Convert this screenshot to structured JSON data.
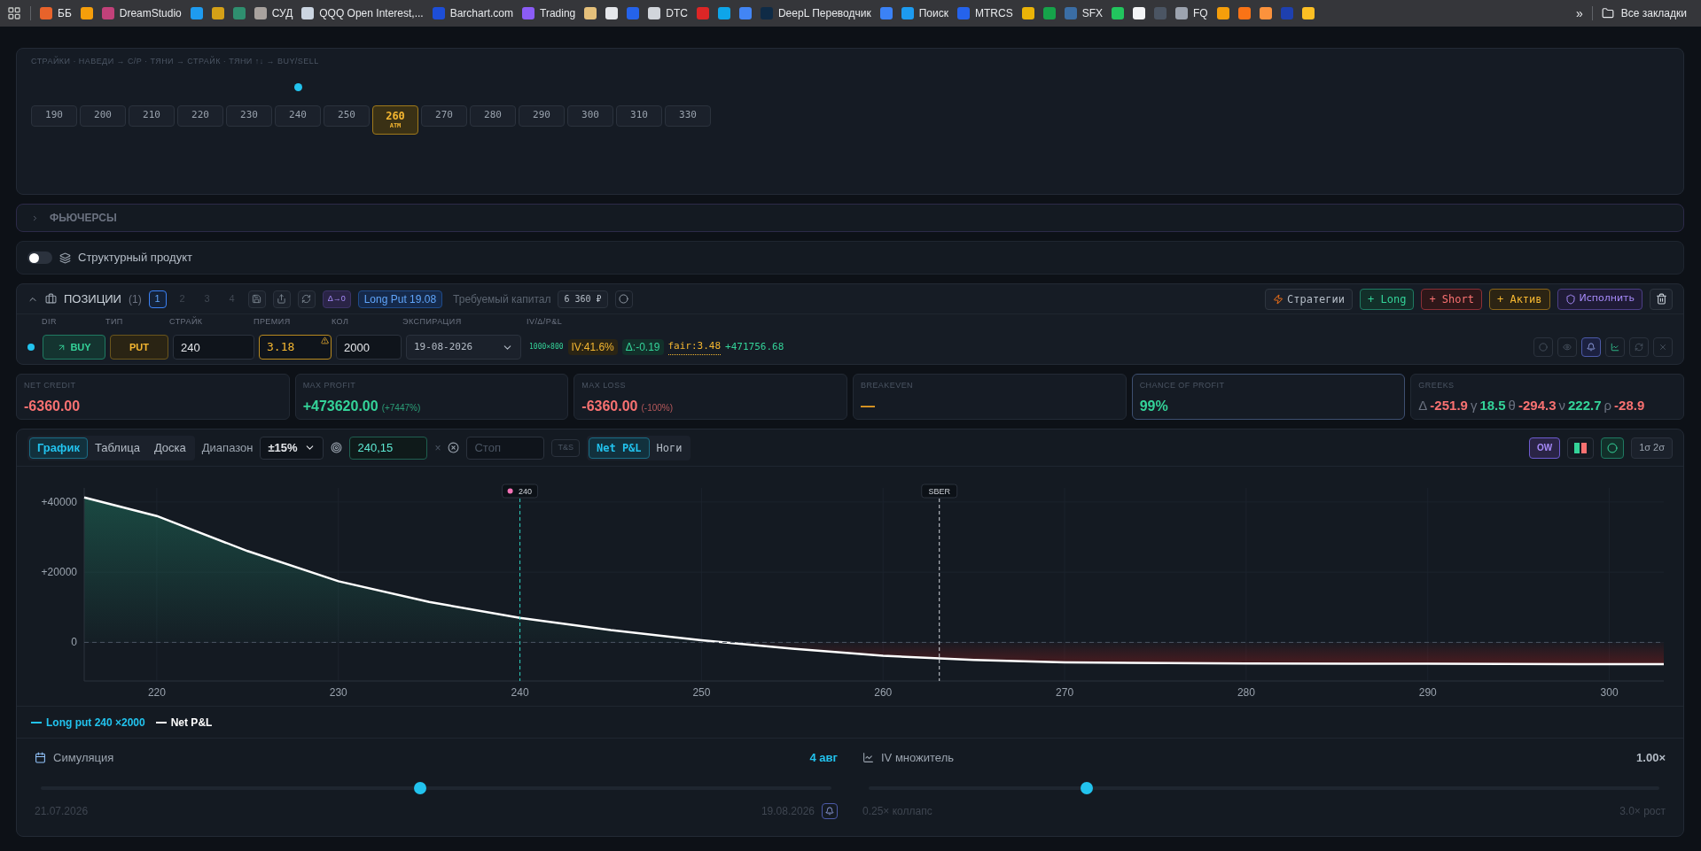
{
  "bookmarks": [
    {
      "label": "ББ",
      "color": "#e8632b"
    },
    {
      "color": "#f59e0b"
    },
    {
      "label": "DreamStudio",
      "color": "#c2417a"
    },
    {
      "color": "#1e9bf0"
    },
    {
      "color": "#d4a017"
    },
    {
      "color": "#2f8f6f"
    },
    {
      "label": "СУД",
      "color": "#a8a29e"
    },
    {
      "label": "QQQ Open Interest,...",
      "color": "#cbd5e1"
    },
    {
      "label": "Barchart.com",
      "color": "#1d4ed8"
    },
    {
      "label": "Trading",
      "color": "#8b5cf6"
    },
    {
      "color": "#e5c07b"
    },
    {
      "color": "#e5e7eb"
    },
    {
      "color": "#2563eb"
    },
    {
      "label": "DTC",
      "color": "#d1d5db"
    },
    {
      "color": "#dc2626"
    },
    {
      "color": "#0ea5e9"
    },
    {
      "color": "#4285f4"
    },
    {
      "label": "DeepL Переводчик",
      "color": "#0f2b46"
    },
    {
      "color": "#3b82f6"
    },
    {
      "label": "Поиск",
      "color": "#1d9bf0"
    },
    {
      "label": "MTRCS",
      "color": "#2563eb"
    },
    {
      "color": "#eab308"
    },
    {
      "color": "#16a34a"
    },
    {
      "label": "SFX",
      "color": "#3b6ea5"
    },
    {
      "color": "#22c55e"
    },
    {
      "color": "#f3f4f6"
    },
    {
      "color": "#4b5563"
    },
    {
      "label": "FQ",
      "color": "#9ca3af"
    },
    {
      "color": "#f59e0b"
    },
    {
      "color": "#f97316"
    },
    {
      "color": "#fb923c"
    },
    {
      "color": "#1e40af"
    },
    {
      "color": "#fbbf24"
    }
  ],
  "bookmarks_more": "»",
  "all_bookmarks": "Все закладки",
  "strikes_panel": {
    "hint": "СТРАЙКИ · НАВЕДИ → C/P · ТЯНИ → СТРАЙК · ТЯНИ ↑↓ → BUY/SELL",
    "strikes": [
      {
        "label": "190",
        "selected": false,
        "dot": false
      },
      {
        "label": "200",
        "selected": false,
        "dot": false
      },
      {
        "label": "210",
        "selected": false,
        "dot": false
      },
      {
        "label": "220",
        "selected": false,
        "dot": false
      },
      {
        "label": "230",
        "selected": false,
        "dot": false
      },
      {
        "label": "240",
        "selected": false,
        "dot": true
      },
      {
        "label": "250",
        "selected": false,
        "dot": false
      },
      {
        "label": "260",
        "selected": true,
        "dot": false,
        "sublabel": "ATM"
      },
      {
        "label": "270",
        "selected": false,
        "dot": false
      },
      {
        "label": "280",
        "selected": false,
        "dot": false
      },
      {
        "label": "290",
        "selected": false,
        "dot": false
      },
      {
        "label": "300",
        "selected": false,
        "dot": false
      },
      {
        "label": "310",
        "selected": false,
        "dot": false
      },
      {
        "label": "330",
        "selected": false,
        "dot": false
      }
    ]
  },
  "futures": {
    "title": "ФЬЮЧЕРСЫ",
    "expanded": false
  },
  "structured": {
    "label": "Структурный продукт",
    "on": false
  },
  "positions": {
    "title": "ПОЗИЦИИ",
    "count": "(1)",
    "expanded": true,
    "pages": [
      {
        "label": "1",
        "selected": true
      },
      {
        "label": "2",
        "selected": false
      },
      {
        "label": "3",
        "selected": false
      },
      {
        "label": "4",
        "selected": false
      }
    ],
    "delta_badge": "Δ→0",
    "strategy_badge": "Long Put 19.08",
    "capital_label": "Требуемый капитал",
    "capital_value": "6 360 ₽",
    "actions": [
      {
        "label": "Стратегии",
        "kind": "strategies"
      },
      {
        "label": "+ Long",
        "kind": "long"
      },
      {
        "label": "+ Short",
        "kind": "short"
      },
      {
        "label": "+ Актив",
        "kind": "asset"
      },
      {
        "label": "Исполнить",
        "kind": "execute"
      }
    ],
    "columns": [
      "DIR",
      "ТИП",
      "СТРАЙК",
      "ПРЕМИЯ",
      "КОЛ",
      "ЭКСПИРАЦИЯ",
      "IV/Δ/P&L"
    ],
    "rows": [
      {
        "direction": "BUY",
        "type": "PUT",
        "strike": "240",
        "premium": "3.18",
        "premium_warning": true,
        "quantity": "2000",
        "expiration": "19-08-2026",
        "bid_ask": "1000×800",
        "iv": "IV:41.6%",
        "delta": "Δ:-0.19",
        "fair": "fair:3.48",
        "pnl": "+471756.68",
        "alert_on": true
      }
    ]
  },
  "metrics": [
    {
      "label": "NET CREDIT",
      "value": "-6360.00",
      "color": "#f87171"
    },
    {
      "label": "MAX PROFIT",
      "value": "+473620.00",
      "note": "(+7447%)",
      "color": "#34d399"
    },
    {
      "label": "MAX LOSS",
      "value": "-6360.00",
      "note": "(-100%)",
      "color": "#f87171"
    },
    {
      "label": "BREAKEVEN",
      "value": "—",
      "color": "#f5a623"
    },
    {
      "label": "CHANCE OF PROFIT",
      "value": "99%",
      "color": "#34d399",
      "selected": true
    },
    {
      "label": "GREEKS",
      "greeks": [
        {
          "symbol": "Δ",
          "value": "-251.9",
          "color": "#f87171"
        },
        {
          "symbol": "γ",
          "value": "18.5",
          "color": "#34d399"
        },
        {
          "symbol": "θ",
          "value": "-294.3",
          "color": "#f87171"
        },
        {
          "symbol": "ν",
          "value": "222.7",
          "color": "#34d399"
        },
        {
          "symbol": "ρ",
          "value": "-28.9",
          "color": "#f87171"
        }
      ]
    }
  ],
  "chart_panel": {
    "view_tabs": [
      {
        "label": "График",
        "selected": true
      },
      {
        "label": "Таблица",
        "selected": false
      },
      {
        "label": "Доска",
        "selected": false
      }
    ],
    "range_label": "Диапазон",
    "range_value": "±15%",
    "target_value": "240,15",
    "clear": "×",
    "stop_placeholder": "Стоп",
    "ts": "T&S",
    "mode_tabs": [
      {
        "label": "Net P&L",
        "selected": true
      },
      {
        "label": "Ноги",
        "selected": false
      }
    ],
    "ow": "OW",
    "sigma": "1σ 2σ",
    "chart_data": {
      "type": "area",
      "x": [
        216,
        220,
        225,
        230,
        235,
        240,
        245,
        250,
        255,
        260,
        265,
        270,
        280,
        290,
        300,
        303
      ],
      "series": [
        {
          "name": "Net P&L",
          "color": "#ffffff",
          "values": [
            41300,
            36000,
            26000,
            17400,
            11500,
            7000,
            3500,
            600,
            -1800,
            -3800,
            -5000,
            -5700,
            -6000,
            -6100,
            -6200,
            -6200
          ]
        }
      ],
      "xlim": [
        216,
        303
      ],
      "ylim": [
        -11000,
        44000
      ],
      "xticks": [
        220,
        230,
        240,
        250,
        260,
        270,
        280,
        290,
        300
      ],
      "yticks": [
        {
          "value": 0,
          "label": "0"
        },
        {
          "value": 20000,
          "label": "+20000"
        },
        {
          "value": 40000,
          "label": "+40000"
        }
      ],
      "grid": true,
      "ref_lines": [
        {
          "axis": "y",
          "value": 0,
          "color": "#4b5563"
        },
        {
          "axis": "x",
          "value": 240,
          "label": "240",
          "color": "#2dd4bf"
        },
        {
          "axis": "x",
          "value": 263.1,
          "label": "SBER",
          "color": "#d1d5db"
        }
      ]
    },
    "legend": [
      {
        "label": "Long put 240 ×2000",
        "color": "#22c3ee"
      }
    ],
    "sliders": [
      {
        "label": "Симуляция",
        "value": "4 авг",
        "min_label": "21.07.2026",
        "max_label": "19.08.2026",
        "level": 0.48,
        "kind": "date"
      },
      {
        "label": "IV множитель",
        "value": "1.00×",
        "min_label": "0.25× коллапс",
        "max_label": "3.0× рост",
        "level": 0.276,
        "kind": "iv"
      }
    ]
  }
}
